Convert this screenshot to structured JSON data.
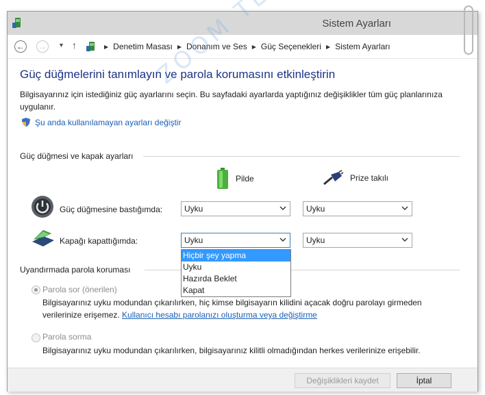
{
  "window": {
    "title": "Sistem Ayarları"
  },
  "breadcrumbs": [
    "Denetim Masası",
    "Donanım ve Ses",
    "Güç Seçenekleri",
    "Sistem Ayarları"
  ],
  "page": {
    "heading": "Güç düğmelerini tanımlayın ve parola korumasını etkinleştirin",
    "description": "Bilgisayarınız için istediğiniz güç ayarlarını seçin. Bu sayfadaki ayarlarda yaptığınız değişiklikler tüm güç planlarınıza uygulanır.",
    "change_link": "Şu anda kullanılamayan ayarları değiştir"
  },
  "power_section": {
    "label": "Güç düğmesi ve kapak ayarları",
    "columns": {
      "battery": "Pilde",
      "plugged": "Prize takılı"
    },
    "rows": [
      {
        "label": "Güç düğmesine bastığımda:",
        "battery": "Uyku",
        "plugged": "Uyku"
      },
      {
        "label": "Kapağı kapattığımda:",
        "battery": "Uyku",
        "plugged": "Uyku"
      }
    ],
    "dropdown_options": [
      "Hiçbir şey yapma",
      "Uyku",
      "Hazırda Beklet",
      "Kapat"
    ],
    "dropdown_highlighted": "Hiçbir şey yapma"
  },
  "password_section": {
    "label": "Uyandırmada parola koruması",
    "option1": {
      "label": "Parola sor (önerilen)",
      "text": "Bilgisayarınız uyku modundan çıkarılırken, hiç kimse bilgisayarın kilidini açacak doğru parolayı girmeden verilerinize erişemez.",
      "link": "Kullanıcı hesabı parolanızı oluşturma veya değiştirme"
    },
    "option2": {
      "label": "Parola sorma",
      "text": "Bilgisayarınız uyku modundan çıkarılırken, bilgisayarınız kilitli olmadığından herkes verilerinize erişebilir."
    }
  },
  "buttons": {
    "save": "Değişiklikleri kaydet",
    "cancel": "İptal"
  },
  "watermark": "ZOOM TEKNO",
  "colors": {
    "heading": "#1e3287",
    "link": "#1a5fb4",
    "highlight": "#3399ff",
    "titlebar": "#d8d8d8"
  }
}
